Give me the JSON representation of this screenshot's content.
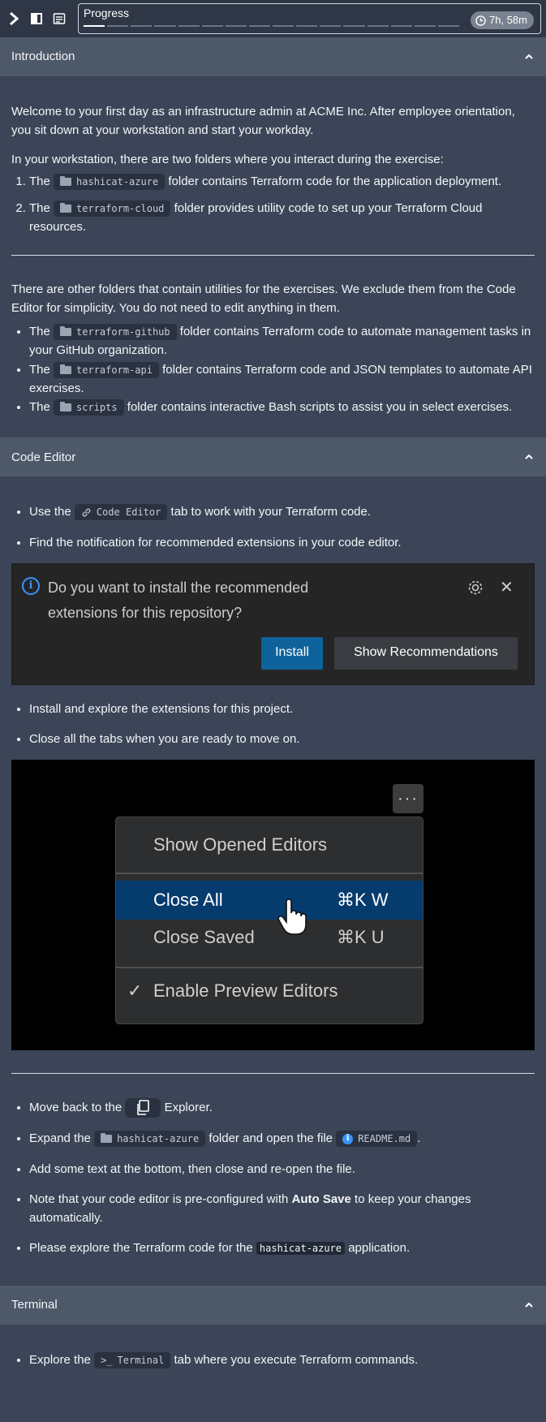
{
  "topbar": {
    "progress_label": "Progress",
    "progress_segments_done": 1,
    "progress_segments_total": 16,
    "timer": "7h, 58m"
  },
  "intro": {
    "header": "Introduction",
    "p1": "Welcome to your first day as an infrastructure admin at ACME Inc. After employee orientation, you sit down at your workstation and start your workday.",
    "p2": "In your workstation, there are two folders where you interact during the exercise:",
    "ol": [
      {
        "pre": "The",
        "chip": "hashicat-azure",
        "post": "folder contains Terraform code for the application deployment."
      },
      {
        "pre": "The",
        "chip": "terraform-cloud",
        "post": "folder provides utility code to set up your Terraform Cloud resources."
      }
    ],
    "p3": "There are other folders that contain utilities for the exercises. We exclude them from the Code Editor for simplicity. You do not need to edit anything in them.",
    "ul": [
      {
        "pre": "The",
        "chip": "terraform-github",
        "post": "folder contains Terraform code to automate management tasks in your GitHub organization."
      },
      {
        "pre": "The",
        "chip": "terraform-api",
        "post": "folder contains Terraform code and JSON templates to automate API exercises."
      },
      {
        "pre": "The",
        "chip": "scripts",
        "post": "folder contains interactive Bash scripts to assist you in select exercises."
      }
    ]
  },
  "code_editor": {
    "header": "Code Editor",
    "b1_pre": "Use the",
    "b1_chip": "Code Editor",
    "b1_post": "tab to work with your Terraform code.",
    "b2": "Find the notification for recommended extensions in your code editor.",
    "notif": {
      "text": "Do you want to install the recommended extensions for this repository?",
      "install": "Install",
      "show": "Show Recommendations"
    },
    "b3": "Install and explore the extensions for this project.",
    "b4": "Close all the tabs when you are ready to move on.",
    "menu": {
      "dots": "···",
      "item1": "Show Opened Editors",
      "item2": "Close All",
      "item2_key": "⌘K W",
      "item3": "Close Saved",
      "item3_key": "⌘K U",
      "item4": "Enable Preview Editors",
      "check": "✓"
    },
    "b5_pre": "Move back to the",
    "b5_post": "Explorer.",
    "b6_pre": "Expand the",
    "b6_chip": "hashicat-azure",
    "b6_mid": "folder and open the file",
    "b6_chip2": "README.md",
    "b6_post": ".",
    "b7": "Add some text at the bottom, then close and re-open the file.",
    "b8_pre": "Note that your code editor is pre-configured with",
    "b8_bold": "Auto Save",
    "b8_post": "to keep your changes automatically.",
    "b9_pre": "Please explore the Terraform code for the",
    "b9_code": "hashicat-azure",
    "b9_post": "application."
  },
  "terminal": {
    "header": "Terminal",
    "b1_pre": "Explore the",
    "b1_chip": "Terminal",
    "b1_post": "tab where you execute Terraform commands."
  },
  "icons": {
    "expand": "chevron-right-icon",
    "panel": "panel-icon",
    "notes": "notes-icon",
    "clock": "clock-icon",
    "collapse": "chevron-up-icon"
  },
  "colors": {
    "background": "#3b4557",
    "header_bg": "#4d5869",
    "accent_blue": "#0e639c"
  }
}
